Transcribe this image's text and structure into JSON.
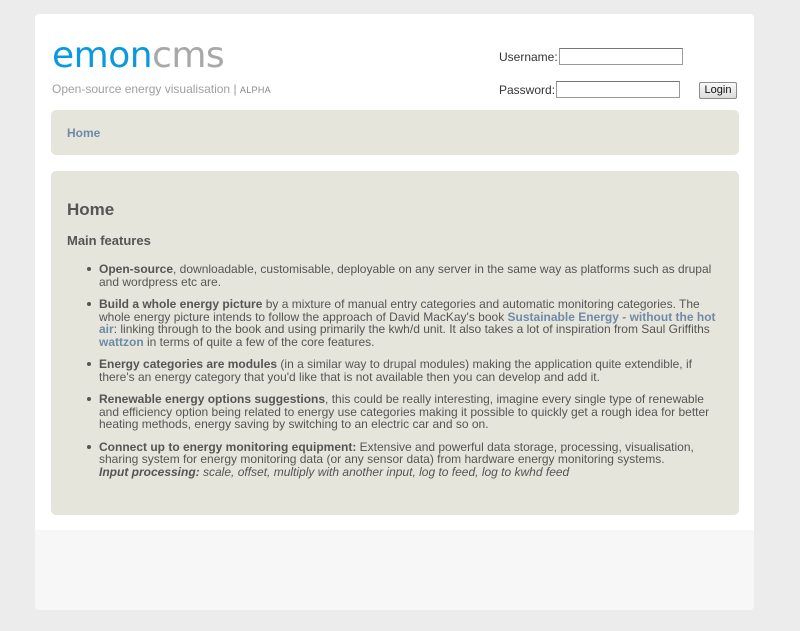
{
  "header": {
    "logo_emon": "emon",
    "logo_cms": "cms",
    "tagline": "Open-source energy visualisation",
    "tagline_sep": "|",
    "tagline_badge": "ALPHA"
  },
  "login": {
    "username_label": "Username:",
    "username_value": "",
    "password_label": "Password:",
    "password_value": "",
    "button_label": "Login"
  },
  "breadcrumb": {
    "home": "Home"
  },
  "main": {
    "title": "Home",
    "subtitle": "Main features",
    "features": [
      {
        "heading": "Open-source",
        "text": ", downloadable, customisable, deployable on any server in the same way as platforms such as drupal and wordpress etc are."
      },
      {
        "heading": "Build a whole energy picture",
        "text1": " by a mixture of manual entry categories and automatic monitoring categories. The whole energy picture intends to follow the approach of  David MacKay's book ",
        "link1": "Sustainable Energy - without the hot air",
        "text2": ": linking through to the book and using primarily the kwh/d unit. It also takes a lot of inspiration from Saul Griffiths ",
        "link2": "wattzon",
        "text3": " in terms of quite a few of the core features."
      },
      {
        "heading": "Energy categories are modules",
        "text": " (in a similar way to drupal modules) making the application quite extendible, if there's an energy category that you'd like that is not available then you can develop and add it."
      },
      {
        "heading": "Renewable energy options suggestions",
        "text": ", this could be really interesting, imagine every single type of renewable and efficiency option being related to energy use categories making it possible to quickly get a rough idea for better heating methods, energy saving by switching to an electric car and so on."
      },
      {
        "heading": "Connect up to energy monitoring equipment:",
        "text": " Extensive and powerful data storage, processing, visualisation, sharing system for energy monitoring data (or any sensor data) from hardware energy monitoring systems.",
        "sub_heading": "Input processing:",
        "sub_text": " scale, offset, multiply with another input, log to feed, log to kwhd feed"
      }
    ]
  },
  "colors": {
    "logo_blue": "#0a99e0",
    "logo_grey": "#a8a8a8",
    "panel_bg": "#e6e5dc",
    "link": "#6d8ba8"
  }
}
